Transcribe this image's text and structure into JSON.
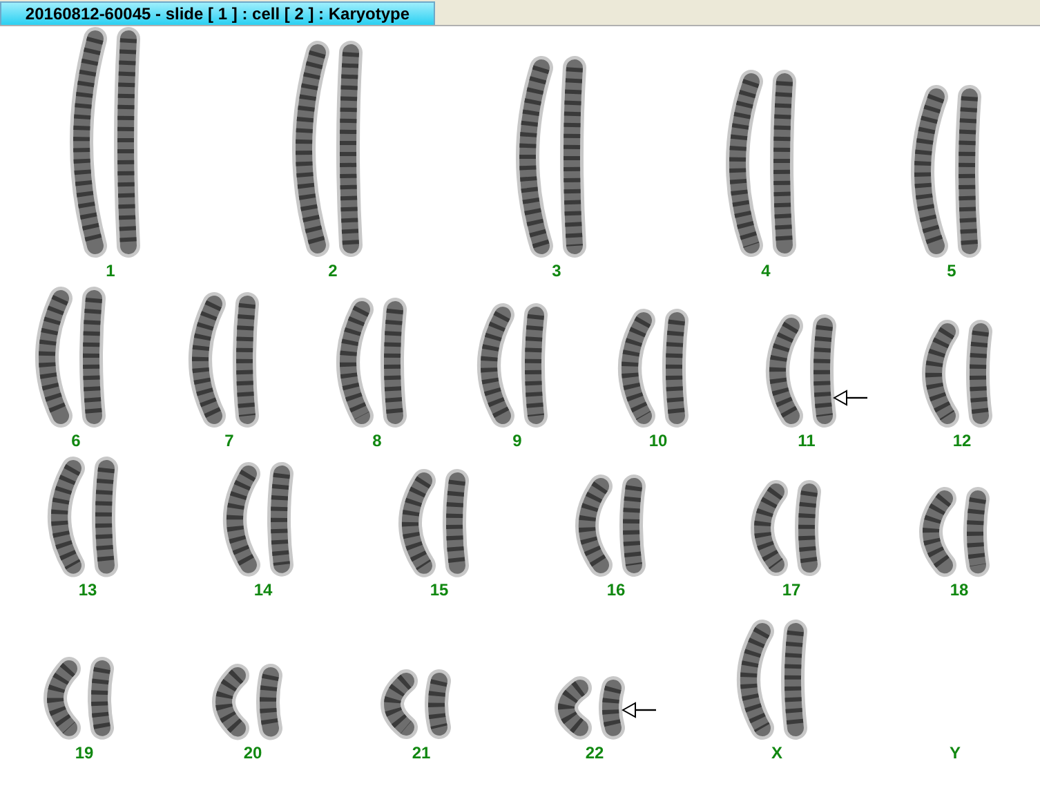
{
  "window": {
    "title": "20160812-60045 - slide [ 1 ] : cell [ 2 ] : Karyotype"
  },
  "rows": [
    {
      "items": [
        {
          "label": "1",
          "kind": "pair",
          "marked": false
        },
        {
          "label": "2",
          "kind": "pair",
          "marked": false
        },
        {
          "label": "3",
          "kind": "pair",
          "marked": false
        },
        {
          "label": "4",
          "kind": "pair",
          "marked": false
        },
        {
          "label": "5",
          "kind": "pair",
          "marked": false
        }
      ]
    },
    {
      "items": [
        {
          "label": "6",
          "kind": "pair",
          "marked": false
        },
        {
          "label": "7",
          "kind": "pair",
          "marked": false
        },
        {
          "label": "8",
          "kind": "pair",
          "marked": false
        },
        {
          "label": "9",
          "kind": "pair",
          "marked": false
        },
        {
          "label": "10",
          "kind": "pair",
          "marked": false
        },
        {
          "label": "11",
          "kind": "pair",
          "marked": true
        },
        {
          "label": "12",
          "kind": "pair",
          "marked": false
        }
      ]
    },
    {
      "items": [
        {
          "label": "13",
          "kind": "pair",
          "marked": false
        },
        {
          "label": "14",
          "kind": "pair",
          "marked": false
        },
        {
          "label": "15",
          "kind": "pair",
          "marked": false
        },
        {
          "label": "16",
          "kind": "pair",
          "marked": false
        },
        {
          "label": "17",
          "kind": "pair",
          "marked": false
        },
        {
          "label": "18",
          "kind": "pair",
          "marked": false
        }
      ]
    },
    {
      "items": [
        {
          "label": "19",
          "kind": "pair",
          "marked": false
        },
        {
          "label": "20",
          "kind": "pair",
          "marked": false
        },
        {
          "label": "21",
          "kind": "pair",
          "marked": false
        },
        {
          "label": "22",
          "kind": "pair",
          "marked": true
        },
        {
          "label": "X",
          "kind": "pair",
          "marked": false
        },
        {
          "label": "Y",
          "kind": "empty",
          "marked": false
        }
      ]
    }
  ]
}
